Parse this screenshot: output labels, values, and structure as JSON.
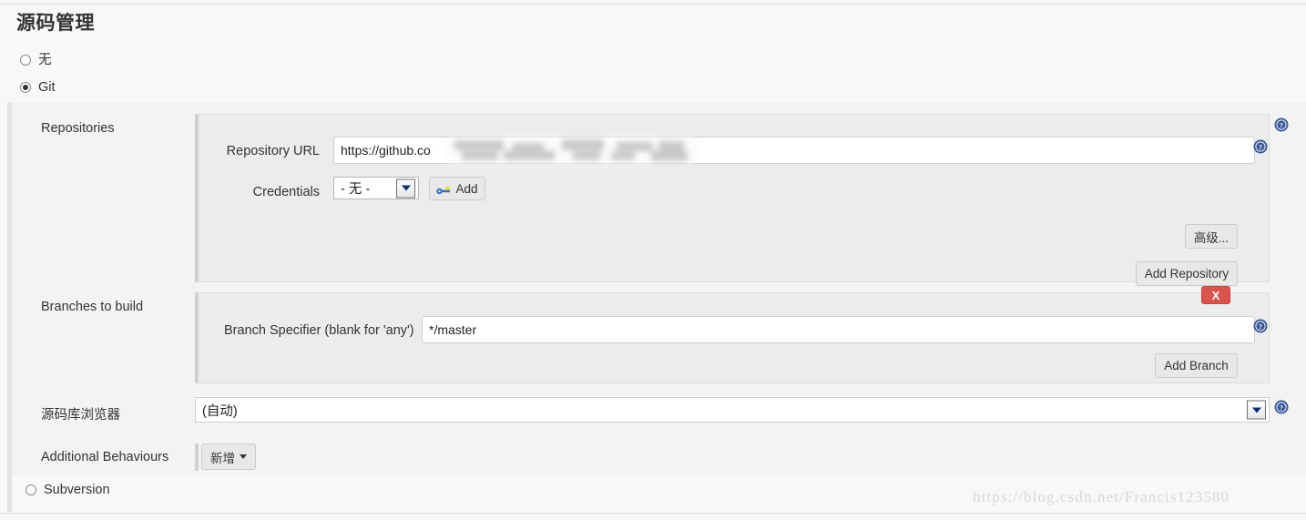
{
  "page": {
    "title": "源码管理",
    "watermark": "https://blog.csdn.net/Francis123580"
  },
  "scm_options": [
    {
      "label": "无",
      "selected": false
    },
    {
      "label": "Git",
      "selected": true
    },
    {
      "label": "Subversion",
      "selected": false
    }
  ],
  "git": {
    "repositories": {
      "row_label": "Repositories",
      "repository_url": {
        "label": "Repository URL",
        "value": "https://github.co",
        "redacted": true
      },
      "credentials": {
        "label": "Credentials",
        "selected": "- 无 -",
        "options": [
          "- 无 -"
        ],
        "add_button": "Add"
      },
      "advanced_button": "高级...",
      "add_repository_button": "Add Repository"
    },
    "branches": {
      "row_label": "Branches to build",
      "branch_specifier": {
        "label": "Branch Specifier (blank for 'any')",
        "value": "*/master"
      },
      "delete_button": "X",
      "add_branch_button": "Add Branch"
    },
    "repository_browser": {
      "row_label": "源码库浏览器",
      "selected": "(自动)",
      "options": [
        "(自动)"
      ]
    },
    "additional_behaviours": {
      "row_label": "Additional Behaviours",
      "add_button": "新增"
    }
  },
  "icons": {
    "help": "help-icon",
    "key": "key-icon",
    "caret_down": "chevron-down-icon"
  },
  "colors": {
    "page_bg": "#f8f8f8",
    "block_bg": "#f3f3f3",
    "panel_bg": "#ececec",
    "danger": "#d9534f",
    "help_blue": "#3b5998",
    "text": "#333333"
  }
}
